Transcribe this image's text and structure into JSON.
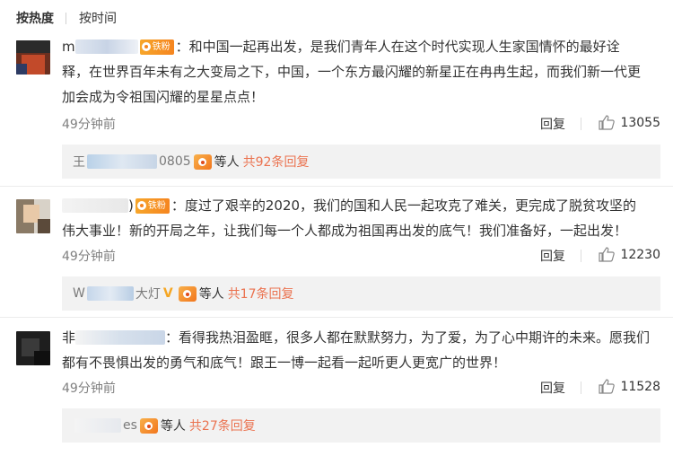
{
  "tabs": {
    "hot": "按热度",
    "time": "按时间"
  },
  "comments": [
    {
      "name_start": "m",
      "badge": "铁粉",
      "lines": [
        "：和中国一起再出发，是我们青年人在这个时代实现人生家国情怀的最好诠",
        "释，在世界百年未有之大变局之下，中国，一个东方最闪耀的新星正在冉冉生起，而我们新一代更",
        "加会成为令祖国闪耀的星星点点！"
      ],
      "time": "49分钟前",
      "reply_label": "回复",
      "likes": "13055",
      "sub": {
        "name_start": "王",
        "name_end": "0805",
        "others": "等人",
        "count": "共92条回复"
      }
    },
    {
      "name_start": ")",
      "badge": "铁粉",
      "lines": [
        "：度过了艰辛的2020，我们的国和人民一起攻克了难关，更完成了脱贫攻坚的",
        "伟大事业！新的开局之年，让我们每一个人都成为祖国再出发的底气！我们准备好，一起出发！"
      ],
      "time": "49分钟前",
      "reply_label": "回复",
      "likes": "12230",
      "sub": {
        "name_start": "W",
        "name_end": "大灯",
        "others": "等人",
        "count": "共17条回复"
      }
    },
    {
      "name_start": "非",
      "badge": "",
      "lines": [
        "：看得我热泪盈眶，很多人都在默默努力，为了爱，为了心中期许的未来。愿我们",
        "都有不畏惧出发的勇气和底气！跟王一博一起看一起听更人更宽广的世界！"
      ],
      "time": "49分钟前",
      "reply_label": "回复",
      "likes": "11528",
      "sub": {
        "name_start": "",
        "name_end": "es",
        "others": "等人",
        "count": "共27条回复"
      }
    }
  ],
  "colors": {
    "link": "#eb7350",
    "badge": "#f5851f",
    "sub_bg": "#f2f2f2"
  },
  "icons": {
    "like": "thumbs-up-icon",
    "badge": "fan-badge-icon"
  }
}
